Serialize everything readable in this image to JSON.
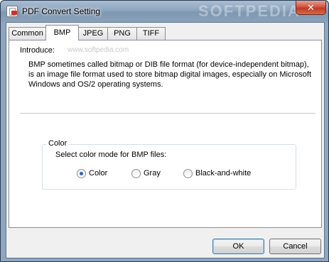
{
  "window": {
    "title": "PDF Convert Setting",
    "watermark": "SOFTPEDIA",
    "close_glyph": "✕"
  },
  "tabs": [
    {
      "label": "Common",
      "active": false
    },
    {
      "label": "BMP",
      "active": true
    },
    {
      "label": "JPEG",
      "active": false
    },
    {
      "label": "PNG",
      "active": false
    },
    {
      "label": "TIFF",
      "active": false
    }
  ],
  "panel": {
    "introduce_label": "Introduce:",
    "faint_mark": "www.softpedia.com",
    "description": "BMP sometimes called bitmap or DIB file format (for device-independent bitmap), is an image file format used to store bitmap digital images, especially on Microsoft Windows and OS/2 operating systems."
  },
  "color_group": {
    "legend": "Color",
    "caption": "Select color mode for BMP files:",
    "options": [
      {
        "label": "Color",
        "selected": true
      },
      {
        "label": "Gray",
        "selected": false
      },
      {
        "label": "Black-and-white",
        "selected": false
      }
    ]
  },
  "buttons": {
    "ok": "OK",
    "cancel": "Cancel"
  }
}
